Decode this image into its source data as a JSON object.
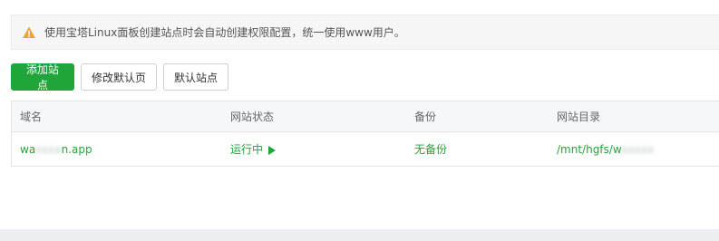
{
  "notice": {
    "text": "使用宝塔Linux面板创建站点时会自动创建权限配置，统一使用www用户。",
    "icon": "warning-icon"
  },
  "toolbar": {
    "add_site": "添加站点",
    "edit_default_page": "修改默认页",
    "default_site": "默认站点"
  },
  "table": {
    "headers": [
      "域名",
      "网站状态",
      "备份",
      "网站目录"
    ],
    "rows": [
      {
        "domain_prefix": "wa",
        "domain_suffix": "n.app",
        "status": "运行中",
        "backup": "无备份",
        "dir_prefix": "/mnt/hgfs/w"
      }
    ]
  },
  "colors": {
    "accent": "#20a53a",
    "warning": "#f0ad4e"
  }
}
